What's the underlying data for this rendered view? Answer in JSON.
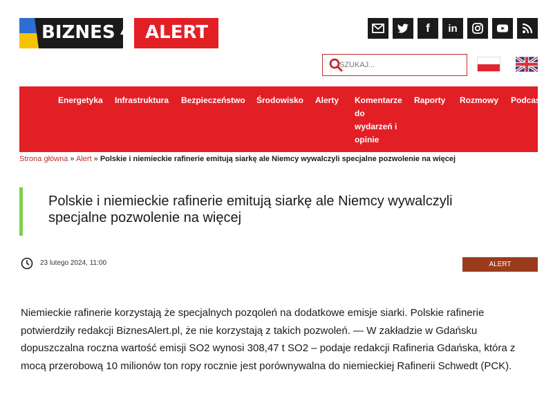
{
  "logo": {
    "word1": "BIZNES",
    "word2": "ALERT"
  },
  "socials": [
    {
      "name": "email-icon"
    },
    {
      "name": "twitter-icon"
    },
    {
      "name": "facebook-icon",
      "glyph": "f"
    },
    {
      "name": "linkedin-icon",
      "glyph": "in"
    },
    {
      "name": "instagram-icon"
    },
    {
      "name": "youtube-icon"
    },
    {
      "name": "rss-icon"
    }
  ],
  "search": {
    "placeholder": "SZUKAJ..."
  },
  "languages": [
    "pl-flag-icon",
    "uk-flag-icon"
  ],
  "nav": {
    "items": [
      {
        "label": "Energetyka"
      },
      {
        "label": "Infrastruktura"
      },
      {
        "label": "Bezpieczeństwo"
      },
      {
        "label": "Środowisko"
      },
      {
        "label": "Alerty"
      },
      {
        "label": "Komentarze\ndo\nwydarzeń i\nopinie"
      },
      {
        "label": "Raporty"
      },
      {
        "label": "Rozmowy"
      },
      {
        "label": "Podcast"
      }
    ]
  },
  "breadcrumb": {
    "home": "Strona główna",
    "sep1": " » ",
    "section": "Alert",
    "sep2": " » ",
    "current": "Polskie i niemieckie rafinerie emitują siarkę ale Niemcy wywalczyli specjalne pozwolenie na więcej"
  },
  "article": {
    "title": "Polskie i niemieckie rafinerie emitują siarkę ale Niemcy wywalczyli specjalne pozwolenie na więcej",
    "date": "23 lutego 2024, 11:00",
    "category": "ALERT",
    "lead": "Niemieckie rafinerie korzystają że specjalnych pozqoleń na dodatkowe emisje siarki. Polskie rafinerie potwierdziły redakcji BiznesAlert.pl, że nie korzystają z takich pozwoleń. — W zakładzie w Gdańsku dopuszczalna roczna wartość emisji SO2 wynosi 308,47 t SO2 – podaje redakcji Rafineria Gdańska, która z mocą przerobową 10 milionów ton ropy rocznie jest porównywalna do niemieckiej Rafinerii Schwedt (PCK)."
  },
  "colors": {
    "brand_red": "#e31f26",
    "accent_green": "#7fcf4e",
    "badge": "#9b3b1e"
  }
}
